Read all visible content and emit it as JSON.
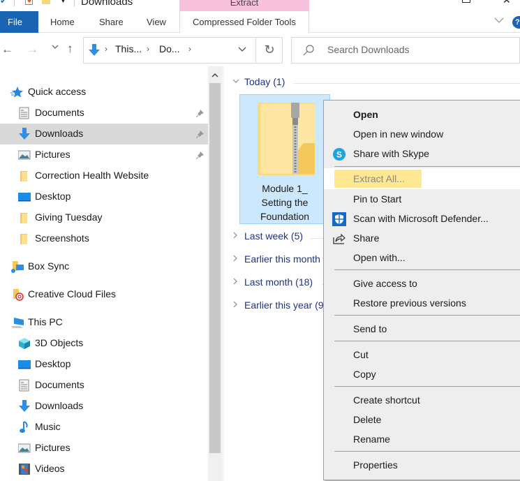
{
  "window": {
    "title": "Downloads",
    "contextual_tab_group": "Extract"
  },
  "ribbon": {
    "tabs": [
      {
        "label": "File"
      },
      {
        "label": "Home"
      },
      {
        "label": "Share"
      },
      {
        "label": "View"
      },
      {
        "label": "Compressed Folder Tools"
      }
    ],
    "help_label": "?"
  },
  "navbar": {
    "breadcrumbs": [
      "This...",
      "Do..."
    ],
    "search_placeholder": "Search Downloads"
  },
  "sidebar": {
    "items": [
      {
        "label": "Quick access",
        "icon": "star-icon",
        "level": 0
      },
      {
        "label": "Documents",
        "icon": "documents-icon",
        "level": 1,
        "pinned": true
      },
      {
        "label": "Downloads",
        "icon": "downloads-icon",
        "level": 1,
        "pinned": true,
        "selected": true
      },
      {
        "label": "Pictures",
        "icon": "pictures-icon",
        "level": 1,
        "pinned": true
      },
      {
        "label": "Correction Health Website",
        "icon": "folder-icon",
        "level": 1
      },
      {
        "label": "Desktop",
        "icon": "desktop-icon",
        "level": 1
      },
      {
        "label": "Giving Tuesday",
        "icon": "folder-icon",
        "level": 1
      },
      {
        "label": "Screenshots",
        "icon": "folder-icon",
        "level": 1
      },
      {
        "label": "Box Sync",
        "icon": "box-sync-icon",
        "level": 0
      },
      {
        "label": "Creative Cloud Files",
        "icon": "creative-cloud-icon",
        "level": 0
      },
      {
        "label": "This PC",
        "icon": "this-pc-icon",
        "level": 0
      },
      {
        "label": "3D Objects",
        "icon": "3d-objects-icon",
        "level": 1
      },
      {
        "label": "Desktop",
        "icon": "desktop-icon",
        "level": 1
      },
      {
        "label": "Documents",
        "icon": "documents-icon",
        "level": 1
      },
      {
        "label": "Downloads",
        "icon": "downloads-icon",
        "level": 1
      },
      {
        "label": "Music",
        "icon": "music-icon",
        "level": 1
      },
      {
        "label": "Pictures",
        "icon": "pictures-icon",
        "level": 1
      },
      {
        "label": "Videos",
        "icon": "videos-icon",
        "level": 1
      }
    ]
  },
  "content": {
    "groups": [
      {
        "label": "Today (1)",
        "expanded": true
      },
      {
        "label": "Last week (5)",
        "expanded": false
      },
      {
        "label": "Earlier this month",
        "expanded": false
      },
      {
        "label": "Last month (18)",
        "expanded": false
      },
      {
        "label": "Earlier this year (9",
        "expanded": false
      }
    ],
    "selected_file": {
      "name_lines": [
        "Module 1_",
        "Setting the",
        "Foundation"
      ],
      "type": "compressed-folder"
    }
  },
  "context_menu": {
    "items": [
      {
        "label": "Open",
        "bold": true
      },
      {
        "label": "Open in new window"
      },
      {
        "label": "Share with Skype",
        "icon": "skype-icon"
      },
      {
        "label": "Extract All...",
        "highlighted": true
      },
      {
        "label": "Pin to Start"
      },
      {
        "label": "Scan with Microsoft Defender...",
        "icon": "defender-icon"
      },
      {
        "label": "Share",
        "icon": "share-icon"
      },
      {
        "label": "Open with..."
      },
      {
        "label": "Give access to"
      },
      {
        "label": "Restore previous versions"
      },
      {
        "label": "Send to"
      },
      {
        "label": "Cut"
      },
      {
        "label": "Copy"
      },
      {
        "label": "Create shortcut"
      },
      {
        "label": "Delete"
      },
      {
        "label": "Rename"
      },
      {
        "label": "Properties"
      }
    ]
  },
  "colors": {
    "file_tab": "#1a64b4",
    "contextual_tab": "#f8c2dd",
    "selection_bg": "#cce8ff",
    "group_header_text": "#1e3287",
    "highlight": "#ffe891"
  }
}
